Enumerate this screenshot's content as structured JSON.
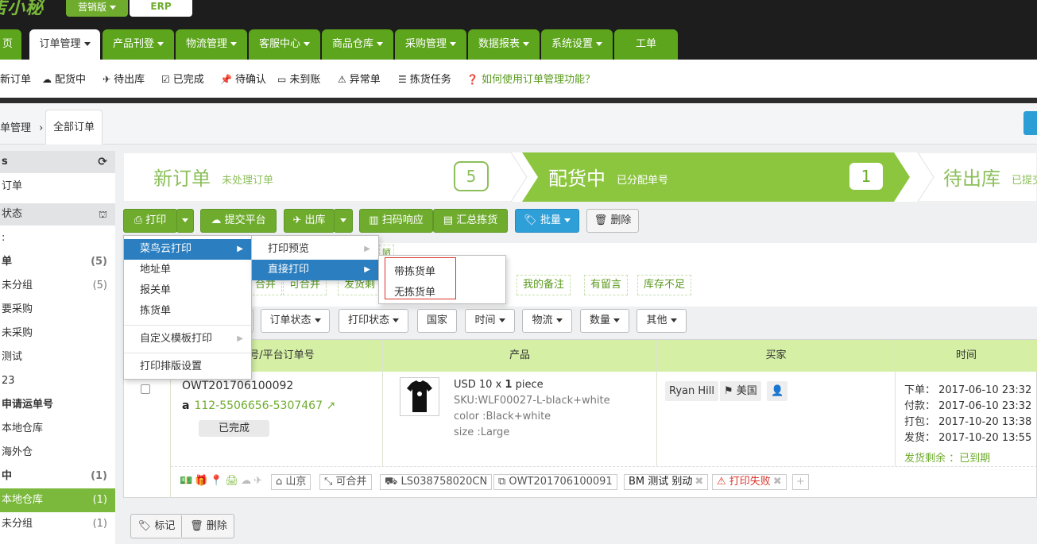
{
  "app": {
    "logo": "店小秘",
    "edition": "营销版",
    "erp": "ERP"
  },
  "main_nav": {
    "tabs": [
      "页",
      "订单管理",
      "产品刊登",
      "物流管理",
      "客服中心",
      "商品仓库",
      "采购管理",
      "数据报表",
      "系统设置",
      "工单"
    ]
  },
  "sub_nav": {
    "items": [
      "新订单",
      "配货中",
      "待出库",
      "已完成",
      "待确认",
      "未到账",
      "异常单",
      "拣货任务"
    ],
    "help": "如何使用订单管理功能？"
  },
  "breadcrumb": {
    "parent": "单管理",
    "tab": "全部订单"
  },
  "sidebar": {
    "head1": "s",
    "item1": "订单",
    "head2": "状态",
    "rows": [
      {
        "label": ":",
        "count": ""
      },
      {
        "label": "单",
        "count": "(5)"
      },
      {
        "label": "未分组",
        "count": "(5)"
      },
      {
        "label": "要采购",
        "count": ""
      },
      {
        "label": "未采购",
        "count": ""
      },
      {
        "label": "测试",
        "count": ""
      },
      {
        "label": "23",
        "count": ""
      },
      {
        "label": "申请运单号",
        "count": ""
      },
      {
        "label": "本地仓库",
        "count": ""
      },
      {
        "label": "海外仓",
        "count": ""
      },
      {
        "label": "中",
        "count": "(1)"
      },
      {
        "label": "本地仓库",
        "count": "(1)"
      },
      {
        "label": "未分组",
        "count": "(1)"
      }
    ]
  },
  "pipeline": {
    "s1": {
      "title": "新订单",
      "sub": "未处理订单",
      "count": "5"
    },
    "s2": {
      "title": "配货中",
      "sub": "已分配单号",
      "count": "1"
    },
    "s3": {
      "title": "待出库",
      "sub": "已提交"
    }
  },
  "toolbar": {
    "print": "打印",
    "submit": "提交平台",
    "ship": "出库",
    "scan": "扫码响应",
    "summary": "汇总拣货",
    "batch": "批量",
    "delete": "删除"
  },
  "filters": {
    "tags": [
      "合并",
      "可合并",
      "发货剩",
      "我的备注",
      "有留言",
      "库存不足"
    ],
    "partial": "时",
    "dropdowns": [
      "订单状态",
      "打印状态",
      "国家",
      "时间",
      "物流",
      "数量",
      "其他"
    ]
  },
  "table": {
    "headers": [
      "单号/平台订单号",
      "产品",
      "买家",
      "时间"
    ],
    "row": {
      "order_no": "OWT201706100092",
      "platform_no": "112-5506656-5307467",
      "status": "已完成",
      "price": "USD 10 x ",
      "qty": "1",
      "unit": " piece",
      "sku": "SKU:WLF00027-L-black+white",
      "color": "color :Black+white",
      "size": "size :Large",
      "buyer": "Ryan Hill",
      "country": "美国",
      "times": [
        "下单： 2017-06-10 23:32",
        "付款： 2017-06-10 23:32",
        "打包： 2017-10-20 13:38",
        "发货： 2017-10-20 13:55"
      ],
      "ship_remain": "发货剩余 ：已到期",
      "footer": {
        "warehouse": "山京",
        "mergeable": "可合并",
        "tracking": "LS038758020CN",
        "order_ref": "OWT201706100091",
        "note": "BM 测试 别动",
        "print_fail": "打印失败"
      }
    }
  },
  "bottom": {
    "mark": "标记",
    "delete": "删除"
  },
  "print_menu": {
    "items": [
      "菜鸟云打印",
      "地址单",
      "报关单",
      "拣货单",
      "自定义模板打印",
      "打印排版设置"
    ]
  },
  "cainiao_menu": {
    "items": [
      "打印预览",
      "直接打印"
    ]
  },
  "direct_menu": {
    "items": [
      "带拣货单",
      "无拣货单"
    ]
  },
  "stray": "陋",
  "colors": {
    "green": "#6fac2e",
    "blue": "#2f9fd8",
    "header_green": "#d5f0a5",
    "highlight": "#2b7fc0"
  }
}
